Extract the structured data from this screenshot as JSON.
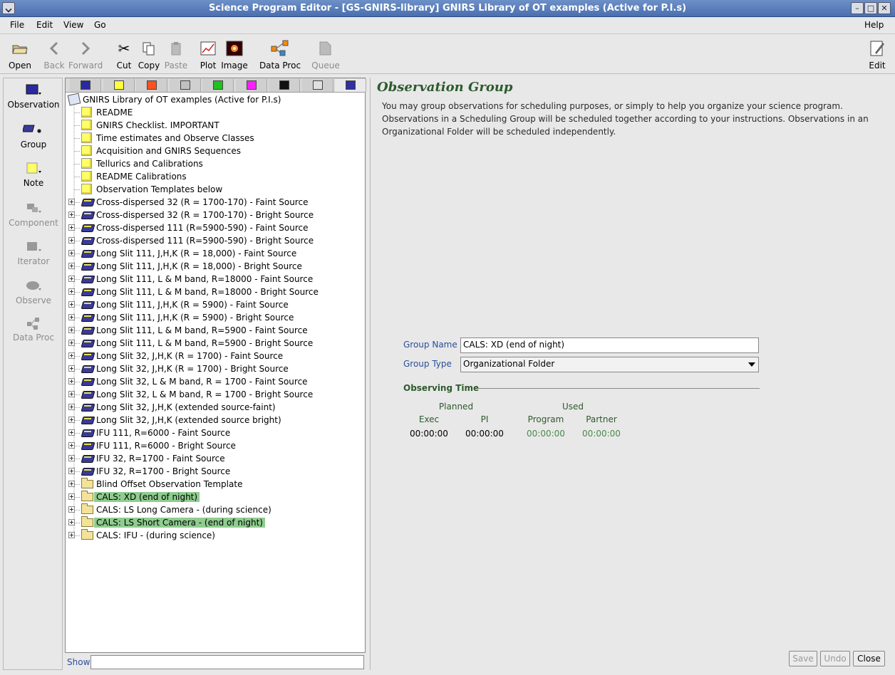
{
  "window": {
    "title": "Science Program Editor - [GS-GNIRS-library] GNIRS Library of OT examples (Active for P.I.s)"
  },
  "menu": {
    "file": "File",
    "edit": "Edit",
    "view": "View",
    "go": "Go",
    "help": "Help"
  },
  "toolbar": {
    "open": "Open",
    "back": "Back",
    "forward": "Forward",
    "cut": "Cut",
    "copy": "Copy",
    "paste": "Paste",
    "plot": "Plot",
    "image": "Image",
    "data_proc": "Data Proc",
    "queue": "Queue",
    "edit": "Edit"
  },
  "palette": {
    "observation": "Observation",
    "group": "Group",
    "note": "Note",
    "component": "Component",
    "iterator": "Iterator",
    "observe": "Observe",
    "data_proc": "Data Proc"
  },
  "tree_tab_colors": [
    "#2a2aa0",
    "#ffff40",
    "#ff5020",
    "#c0c0c0",
    "#20c020",
    "#ff20ff",
    "#111111",
    "#e0e0e0",
    "#3030a0"
  ],
  "tree": {
    "root": "GNIRS Library of OT examples (Active for P.I.s)",
    "items": [
      {
        "type": "note",
        "label": "README"
      },
      {
        "type": "note",
        "label": "GNIRS Checklist.  IMPORTANT"
      },
      {
        "type": "note",
        "label": "Time estimates and Observe Classes"
      },
      {
        "type": "note",
        "label": "Acquisition and GNIRS Sequences"
      },
      {
        "type": "note",
        "label": "Tellurics and Calibrations"
      },
      {
        "type": "note",
        "label": "README Calibrations"
      },
      {
        "type": "note",
        "label": "Observation Templates below"
      },
      {
        "type": "obs",
        "label": "Cross-dispersed 32 (R = 1700-170) - Faint Source"
      },
      {
        "type": "obs",
        "label": "Cross-dispersed 32 (R = 1700-170) - Bright Source"
      },
      {
        "type": "obs",
        "label": "Cross-dispersed 111 (R=5900-590) - Faint Source"
      },
      {
        "type": "obs",
        "label": "Cross-dispersed 111 (R=5900-590) - Bright Source"
      },
      {
        "type": "obs",
        "label": "Long Slit 111,  J,H,K (R = 18,000) - Faint Source"
      },
      {
        "type": "obs",
        "label": "Long Slit 111,  J,H,K (R = 18,000) - Bright Source"
      },
      {
        "type": "obs",
        "label": "Long Slit 111,  L & M band, R=18000 - Faint Source"
      },
      {
        "type": "obs",
        "label": "Long Slit 111,  L & M band, R=18000 - Bright Source"
      },
      {
        "type": "obs",
        "label": "Long Slit 111,  J,H,K (R = 5900) - Faint Source"
      },
      {
        "type": "obs",
        "label": "Long Slit 111,  J,H,K (R = 5900) - Bright Source"
      },
      {
        "type": "obs",
        "label": "Long Slit 111,  L & M band, R=5900 - Faint Source"
      },
      {
        "type": "obs",
        "label": "Long Slit 111,  L & M band, R=5900 - Bright Source"
      },
      {
        "type": "obs",
        "label": "Long Slit 32,  J,H,K (R = 1700) - Faint Source"
      },
      {
        "type": "obs",
        "label": "Long Slit 32,  J,H,K (R = 1700) - Bright Source"
      },
      {
        "type": "obs",
        "label": "Long Slit 32,  L & M band, R = 1700 - Faint Source"
      },
      {
        "type": "obs",
        "label": "Long Slit 32,  L & M band, R = 1700 - Bright Source"
      },
      {
        "type": "obs",
        "label": "Long Slit 32, J,H,K (extended source-faint)"
      },
      {
        "type": "obs",
        "label": "Long Slit 32, J,H,K (extended source bright)"
      },
      {
        "type": "obs",
        "label": "IFU 111, R=6000 - Faint Source"
      },
      {
        "type": "obs",
        "label": "IFU 111, R=6000 - Bright Source"
      },
      {
        "type": "obs",
        "label": "IFU 32, R=1700 - Faint Source"
      },
      {
        "type": "obs",
        "label": "IFU 32, R=1700 - Bright Source"
      },
      {
        "type": "folder",
        "label": "Blind Offset Observation Template"
      },
      {
        "type": "folder",
        "label": "CALS: XD (end of night)",
        "highlight": true
      },
      {
        "type": "folder",
        "label": "CALS: LS Long Camera - (during science)"
      },
      {
        "type": "folder",
        "label": "CALS: LS Short Camera - (end of night)",
        "highlight": true
      },
      {
        "type": "folder",
        "label": "CALS: IFU - (during science)"
      }
    ]
  },
  "show": {
    "label": "Show",
    "value": ""
  },
  "editor": {
    "heading": "Observation Group",
    "description": "You may group observations for scheduling purposes, or simply to help you organize your science program. Observations in a Scheduling Group will be scheduled together according to your instructions. Observations in an Organizational Folder will be scheduled independently.",
    "group_name_label": "Group Name",
    "group_name_value": "CALS: XD (end of night)",
    "group_type_label": "Group Type",
    "group_type_value": "Organizational Folder",
    "observing_time_title": "Observing Time",
    "planned_label": "Planned",
    "used_label": "Used",
    "exec_label": "Exec",
    "pi_label": "PI",
    "program_label": "Program",
    "partner_label": "Partner",
    "exec_value": "00:00:00",
    "pi_value": "00:00:00",
    "program_value": "00:00:00",
    "partner_value": "00:00:00"
  },
  "buttons": {
    "save": "Save",
    "undo": "Undo",
    "close": "Close"
  }
}
